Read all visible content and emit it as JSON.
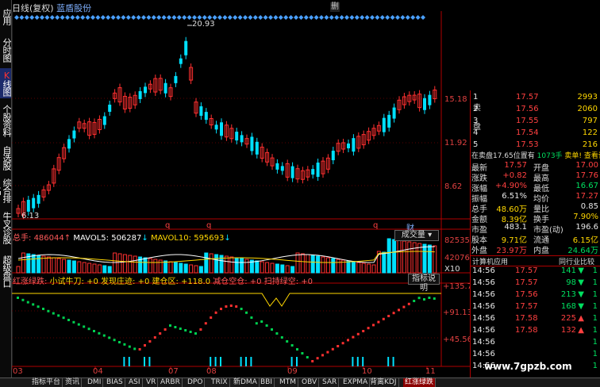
{
  "left_tabs": [
    "应用",
    "分时图",
    "K线图",
    "个股资料",
    "自选股",
    "综合排名",
    "牛叉诊股",
    "超级盘口"
  ],
  "header": {
    "period": "日线(复权)",
    "stock_name": "蓝盾股份",
    "close_label": "删"
  },
  "main_chart": {
    "price_labels": [
      "15.18",
      "11.92",
      "8.62"
    ],
    "max_label": "20.93",
    "min_label": "6.13",
    "q_markers": [
      "q",
      "q",
      "q",
      "财"
    ]
  },
  "volume_panel": {
    "vol_label": "总手",
    "vol_value": "486044",
    "ma5_label": "MAVOL5",
    "ma5_value": "506287",
    "ma10_label": "MAVOL10",
    "ma10_value": "595693",
    "select_value": "成交量",
    "axis_labels": [
      "82535",
      "42076",
      "X10"
    ]
  },
  "indicator_panel": {
    "name": "红涨绿跌",
    "items": [
      {
        "label": "小试牛刀",
        "value": "+0"
      },
      {
        "label": "发现庄迹",
        "value": "+0"
      },
      {
        "label": "建仓区",
        "value": "+118.0"
      },
      {
        "label": "减仓空仓",
        "value": "+0"
      },
      {
        "label": "扫持绿空",
        "value": "+0"
      }
    ],
    "help_button": "指标说明",
    "axis_labels": [
      "+135.7",
      "+91.13",
      "+45.56"
    ]
  },
  "date_axis": [
    "03",
    "04",
    "07",
    "08",
    "09",
    "10",
    "11"
  ],
  "order_book": {
    "side_label_sell": "卖",
    "side_label_buy": "盘",
    "sells": [
      {
        "level": "1",
        "price": "17.57",
        "vol": "2993"
      },
      {
        "level": "2",
        "price": "17.56",
        "vol": "2060"
      },
      {
        "level": "3",
        "price": "17.55",
        "vol": "797"
      },
      {
        "level": "4",
        "price": "17.54",
        "vol": "122"
      },
      {
        "level": "5",
        "price": "17.53",
        "vol": "216"
      }
    ],
    "notice": "在卖盘17.65位置有",
    "notice_vol": "1073手",
    "notice_tail": "卖单!",
    "notice_link": "查看详细"
  },
  "quote": [
    {
      "k1": "最新",
      "v1": "17.57",
      "k2": "开盘",
      "v2": "17.00",
      "c1": "red",
      "c2": "red"
    },
    {
      "k1": "涨跌",
      "v1": "+0.82",
      "k2": "最高",
      "v2": "17.76",
      "c1": "red",
      "c2": "red"
    },
    {
      "k1": "涨幅",
      "v1": "+4.90%",
      "k2": "最低",
      "v2": "16.67",
      "c1": "red",
      "c2": "green"
    },
    {
      "k1": "振幅",
      "v1": "6.51%",
      "k2": "均价",
      "v2": "17.27",
      "c1": "white",
      "c2": "red"
    },
    {
      "k1": "总手",
      "v1": "48.60万",
      "k2": "量比",
      "v2": "0.85",
      "c1": "yellow",
      "c2": "white"
    },
    {
      "k1": "金额",
      "v1": "8.39亿",
      "k2": "换手",
      "v2": "7.90%",
      "c1": "yellow",
      "c2": "yellow"
    },
    {
      "k1": "市盈",
      "v1": "483.1",
      "k2": "市盈(动)",
      "v2": "196.6",
      "c1": "white",
      "c2": "white"
    },
    {
      "k1": "股本",
      "v1": "9.71亿",
      "k2": "流通",
      "v2": "6.15亿",
      "c1": "yellow",
      "c2": "yellow"
    },
    {
      "k1": "外盘",
      "v1": "23.97万",
      "k2": "内盘",
      "v2": "24.64万",
      "c1": "red",
      "c2": "green"
    }
  ],
  "panel_tabs": [
    "计算机应用",
    "同行业比较"
  ],
  "ticks": [
    {
      "time": "14:56",
      "price": "17.57",
      "vol": "141",
      "dir": "down"
    },
    {
      "time": "14:56",
      "price": "17.57",
      "vol": "98",
      "dir": "down"
    },
    {
      "time": "14:56",
      "price": "17.56",
      "vol": "213",
      "dir": "down"
    },
    {
      "time": "14:56",
      "price": "17.57",
      "vol": "168",
      "dir": "down"
    },
    {
      "time": "14:56",
      "price": "17.58",
      "vol": "225",
      "dir": "up"
    },
    {
      "time": "14:56",
      "price": "17.58",
      "vol": "132",
      "dir": "up"
    },
    {
      "time": "14:56",
      "price": "",
      "vol": "",
      "dir": ""
    },
    {
      "time": "14:56",
      "price": "",
      "vol": "",
      "dir": ""
    },
    {
      "time": "14:56",
      "price": "",
      "vol": "",
      "dir": ""
    }
  ],
  "bottom_tabs": [
    "指标平台",
    "资讯",
    "DMI",
    "BIAS",
    "ASI",
    "VR",
    "ARBR",
    "DPO",
    "TRIX",
    "新DMA",
    "BBI",
    "MTM",
    "OBV",
    "SAR",
    "EXPMA",
    "背离KDJ",
    "红涨绿跌"
  ],
  "watermark": "www.7gpzb.com",
  "colors": {
    "up": "#ff3030",
    "down": "#00e0ff",
    "frame": "#b00000",
    "ma_yellow": "#ffd700"
  }
}
